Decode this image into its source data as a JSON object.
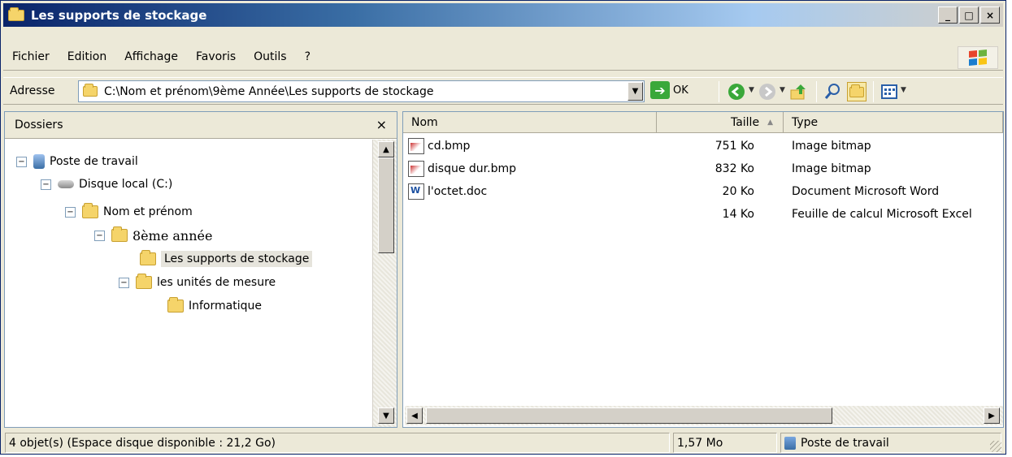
{
  "window": {
    "title": "Les supports de stockage"
  },
  "title_controls": {
    "minimize": "_",
    "maximize": "□",
    "close": "×"
  },
  "menu": [
    "Fichier",
    "Edition",
    "Affichage",
    "Favoris",
    "Outils",
    "?"
  ],
  "address": {
    "label": "Adresse",
    "value": "C:\\Nom et prénom\\9ème Année\\Les supports de stockage",
    "go_label": "OK"
  },
  "folders_pane": {
    "title": "Dossiers",
    "close": "×",
    "tree": [
      {
        "label": "Poste de travail",
        "expander": "−",
        "icon": "computer-icon"
      },
      {
        "label": "Disque local (C:)",
        "expander": "−",
        "icon": "drive-icon"
      },
      {
        "label": "Nom et prénom",
        "expander": "−",
        "icon": "folder-icon"
      },
      {
        "label": "8ème année",
        "expander": "−",
        "icon": "folder-icon"
      },
      {
        "label": "Les supports de stockage",
        "expander": "",
        "icon": "folder-open-icon",
        "selected": true
      },
      {
        "label": "les unités de mesure",
        "expander": "−",
        "icon": "folder-icon"
      },
      {
        "label": "Informatique",
        "expander": "",
        "icon": "folder-icon"
      }
    ]
  },
  "files": {
    "columns": {
      "name": "Nom",
      "size": "Taille",
      "type": "Type"
    },
    "rows": [
      {
        "name": "cd.bmp",
        "size": "751 Ko",
        "type": "Image bitmap",
        "icon": "bitmap-icon"
      },
      {
        "name": "disque dur.bmp",
        "size": "832 Ko",
        "type": "Image bitmap",
        "icon": "bitmap-icon"
      },
      {
        "name": "l'octet.doc",
        "size": "20 Ko",
        "type": "Document Microsoft Word",
        "icon": "word-doc-icon"
      },
      {
        "name": "",
        "size": "14 Ko",
        "type": "Feuille de calcul Microsoft Excel",
        "icon": ""
      }
    ]
  },
  "status": {
    "objects": "4 objet(s) (Espace disque disponible : 21,2 Go)",
    "size": "1,57 Mo",
    "location": "Poste de travail"
  }
}
